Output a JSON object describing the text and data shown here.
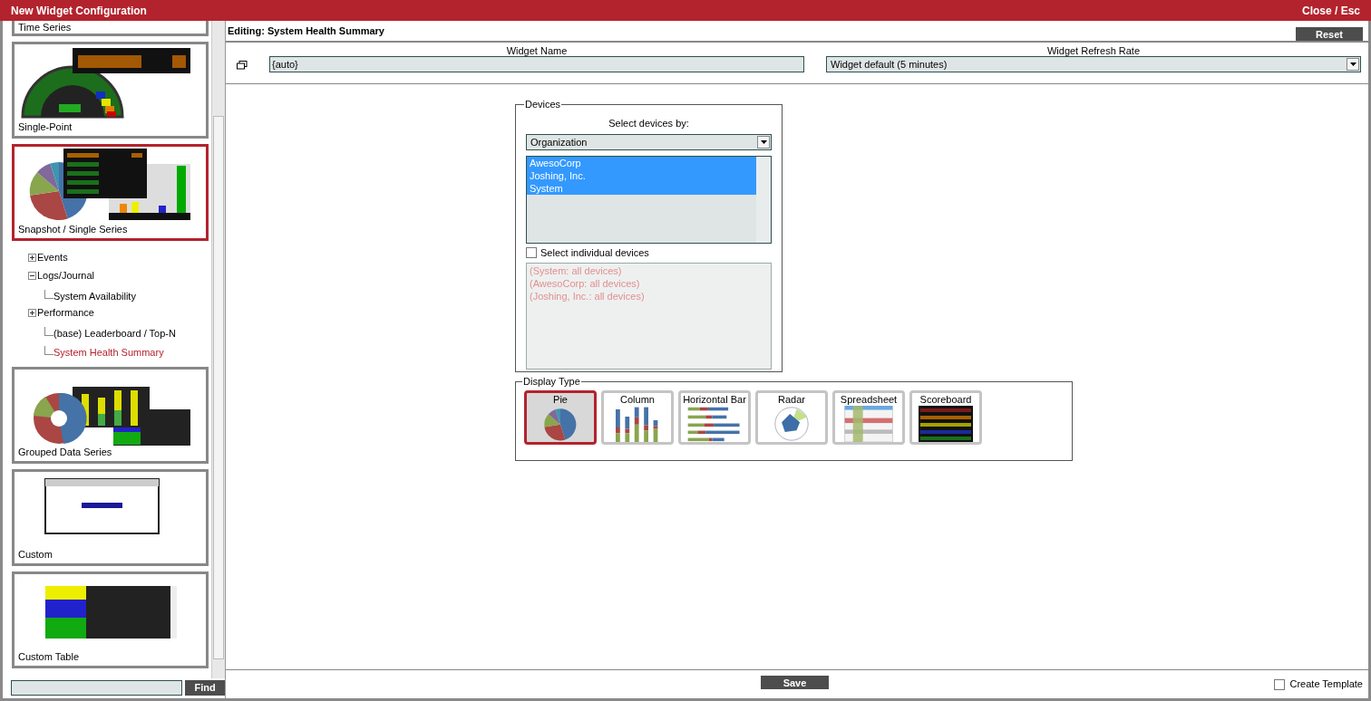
{
  "window": {
    "title": "New Widget Configuration",
    "close": "Close / Esc"
  },
  "sidebar": {
    "cards_before": [
      {
        "label": "Time Series",
        "kind": "partial",
        "selected": false
      },
      {
        "label": "Single-Point",
        "kind": "gauge",
        "selected": false
      },
      {
        "label": "Snapshot / Single Series",
        "kind": "snapshot",
        "selected": true
      }
    ],
    "tree": [
      {
        "label": "Events",
        "expanded": false
      },
      {
        "label": "Logs/Journal",
        "expanded": true,
        "children": [
          {
            "label": "System Availability",
            "selected": false
          }
        ]
      },
      {
        "label": "Performance",
        "expanded": false,
        "children": [
          {
            "label": "(base) Leaderboard / Top-N",
            "selected": false
          },
          {
            "label": "System Health Summary",
            "selected": true
          }
        ]
      }
    ],
    "cards_after": [
      {
        "label": "Grouped Data Series",
        "kind": "grouped",
        "selected": false
      },
      {
        "label": "Custom",
        "kind": "browser",
        "selected": false
      },
      {
        "label": "Custom Table",
        "kind": "table",
        "selected": false
      }
    ],
    "find_button": "Find"
  },
  "editor": {
    "title": "Editing: System Health Summary",
    "reset_button": "Reset",
    "widget_name": {
      "label": "Widget Name",
      "value": "{auto}"
    },
    "refresh_rate": {
      "label": "Widget Refresh Rate",
      "value": "Widget default (5 minutes)"
    },
    "devices": {
      "legend": "Devices",
      "select_by_label": "Select devices by:",
      "select_by": "Organization",
      "organizations": [
        {
          "label": "AwesoCorp",
          "selected": true
        },
        {
          "label": "Joshing, Inc.",
          "selected": true
        },
        {
          "label": "System",
          "selected": true
        }
      ],
      "individual": {
        "label": "Select individual devices",
        "checked": false
      },
      "device_list": [
        "(System: all devices)",
        "(AwesoCorp: all devices)",
        "(Joshing, Inc.: all devices)"
      ]
    },
    "display_type": {
      "legend": "Display Type",
      "options": [
        {
          "label": "Pie",
          "kind": "pie",
          "selected": true
        },
        {
          "label": "Column",
          "kind": "column",
          "selected": false
        },
        {
          "label": "Horizontal Bar",
          "kind": "hbar",
          "selected": false
        },
        {
          "label": "Radar",
          "kind": "radar",
          "selected": false
        },
        {
          "label": "Spreadsheet",
          "kind": "spreadsheet",
          "selected": false
        },
        {
          "label": "Scoreboard",
          "kind": "scoreboard",
          "selected": false
        }
      ]
    },
    "save_button": "Save",
    "create_template": {
      "label": "Create Template",
      "checked": false
    }
  }
}
